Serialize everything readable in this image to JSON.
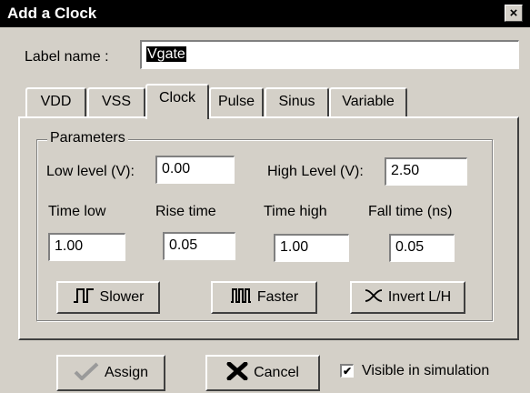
{
  "window": {
    "title": "Add a Clock",
    "close_glyph": "×"
  },
  "label_row": {
    "label": "Label name :",
    "value": "Vgate"
  },
  "tabs": [
    {
      "label": "VDD"
    },
    {
      "label": "VSS"
    },
    {
      "label": "Clock",
      "active": true
    },
    {
      "label": "Pulse"
    },
    {
      "label": "Sinus"
    },
    {
      "label": "Variable"
    }
  ],
  "parameters": {
    "title": "Parameters",
    "low_level_label": "Low level (V):",
    "low_level_value": "0.00",
    "high_level_label": "High Level (V):",
    "high_level_value": "2.50",
    "time_low_label": "Time low",
    "time_low_value": "1.00",
    "rise_time_label": "Rise time",
    "rise_time_value": "0.05",
    "time_high_label": "Time high",
    "time_high_value": "1.00",
    "fall_time_label": "Fall time (ns)",
    "fall_time_value": "0.05",
    "slower_label": "Slower",
    "faster_label": "Faster",
    "invert_label": "Invert L/H"
  },
  "footer": {
    "assign_label": "Assign",
    "cancel_label": "Cancel",
    "visible_label": "Visible in simulation",
    "visible_checked": true,
    "check_glyph": "✔"
  },
  "icons": {
    "slower": "slow-clock-wave-icon",
    "faster": "fast-clock-wave-icon",
    "invert": "invert-icon",
    "assign": "checkmark-icon",
    "cancel": "x-mark-icon"
  }
}
